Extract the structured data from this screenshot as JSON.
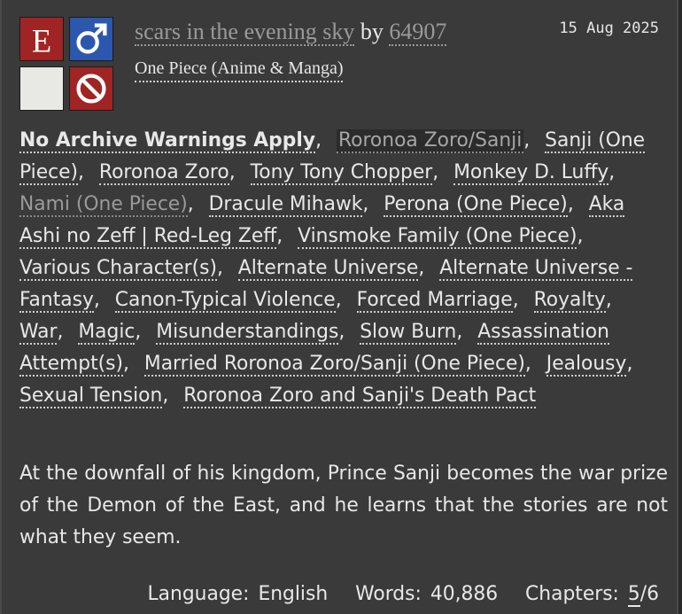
{
  "work": {
    "title": "scars in the evening sky",
    "by": "by",
    "author": "64907",
    "fandom": "One Piece (Anime & Manga)",
    "date": "15 Aug 2025"
  },
  "symbols": {
    "rating": "E",
    "category_icon": "male-symbol-icon",
    "warning_icon": "blank-warning-icon",
    "completion_icon": "incomplete-icon"
  },
  "tags": [
    {
      "label": "No Archive Warnings Apply",
      "kind": "warning"
    },
    {
      "label": "Roronoa Zoro/Sanji",
      "kind": "highlight"
    },
    {
      "label": "Sanji (One Piece)",
      "kind": "normal"
    },
    {
      "label": "Roronoa Zoro",
      "kind": "normal"
    },
    {
      "label": "Tony Tony Chopper",
      "kind": "normal"
    },
    {
      "label": "Monkey D. Luffy",
      "kind": "normal"
    },
    {
      "label": "Nami (One Piece)",
      "kind": "dim"
    },
    {
      "label": "Dracule Mihawk",
      "kind": "normal"
    },
    {
      "label": "Perona (One Piece)",
      "kind": "normal"
    },
    {
      "label": "Aka Ashi no Zeff | Red-Leg Zeff",
      "kind": "normal"
    },
    {
      "label": "Vinsmoke Family (One Piece)",
      "kind": "normal"
    },
    {
      "label": "Various Character(s)",
      "kind": "normal"
    },
    {
      "label": "Alternate Universe",
      "kind": "normal"
    },
    {
      "label": "Alternate Universe - Fantasy",
      "kind": "normal"
    },
    {
      "label": "Canon-Typical Violence",
      "kind": "normal"
    },
    {
      "label": "Forced Marriage",
      "kind": "normal"
    },
    {
      "label": "Royalty",
      "kind": "normal"
    },
    {
      "label": "War",
      "kind": "normal"
    },
    {
      "label": "Magic",
      "kind": "normal"
    },
    {
      "label": "Misunderstandings",
      "kind": "normal"
    },
    {
      "label": "Slow Burn",
      "kind": "normal"
    },
    {
      "label": "Assassination Attempt(s)",
      "kind": "normal"
    },
    {
      "label": "Married Roronoa Zoro/Sanji (One Piece)",
      "kind": "normal"
    },
    {
      "label": "Jealousy",
      "kind": "normal"
    },
    {
      "label": "Sexual Tension",
      "kind": "normal"
    },
    {
      "label": "Roronoa Zoro and Sanji's Death Pact",
      "kind": "normal"
    }
  ],
  "summary": "At the downfall of his kingdom, Prince Sanji becomes the war prize of the Demon of the East, and he learns that the stories are not what they seem.",
  "stats": {
    "language_label": "Language:",
    "language": "English",
    "words_label": "Words:",
    "words": "40,886",
    "chapters_label": "Chapters:",
    "chapters_posted": "5",
    "chapters_total": "/6"
  }
}
